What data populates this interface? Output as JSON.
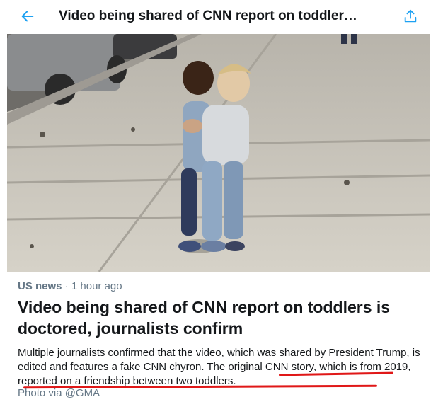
{
  "header": {
    "title": "Video being shared of CNN report on toddler…",
    "back_icon": "arrow-left-icon",
    "share_icon": "share-upload-icon",
    "accent": "#1da1f2"
  },
  "photo": {
    "alt": ""
  },
  "article": {
    "category": "US news",
    "separator": "·",
    "time": "1 hour ago",
    "headline": "Video being shared of CNN report on toddlers is doctored, journalists confirm",
    "summary_part1": "Multiple journalists confirmed that the video, which was shared by President Trump, is edited and features a fake CNN chyron. ",
    "summary_part2": "The original CNN story, which is from 2019, reported on a friendship between two toddlers.",
    "credit": "Photo via @GMA",
    "highlight_color": "#e01818"
  }
}
